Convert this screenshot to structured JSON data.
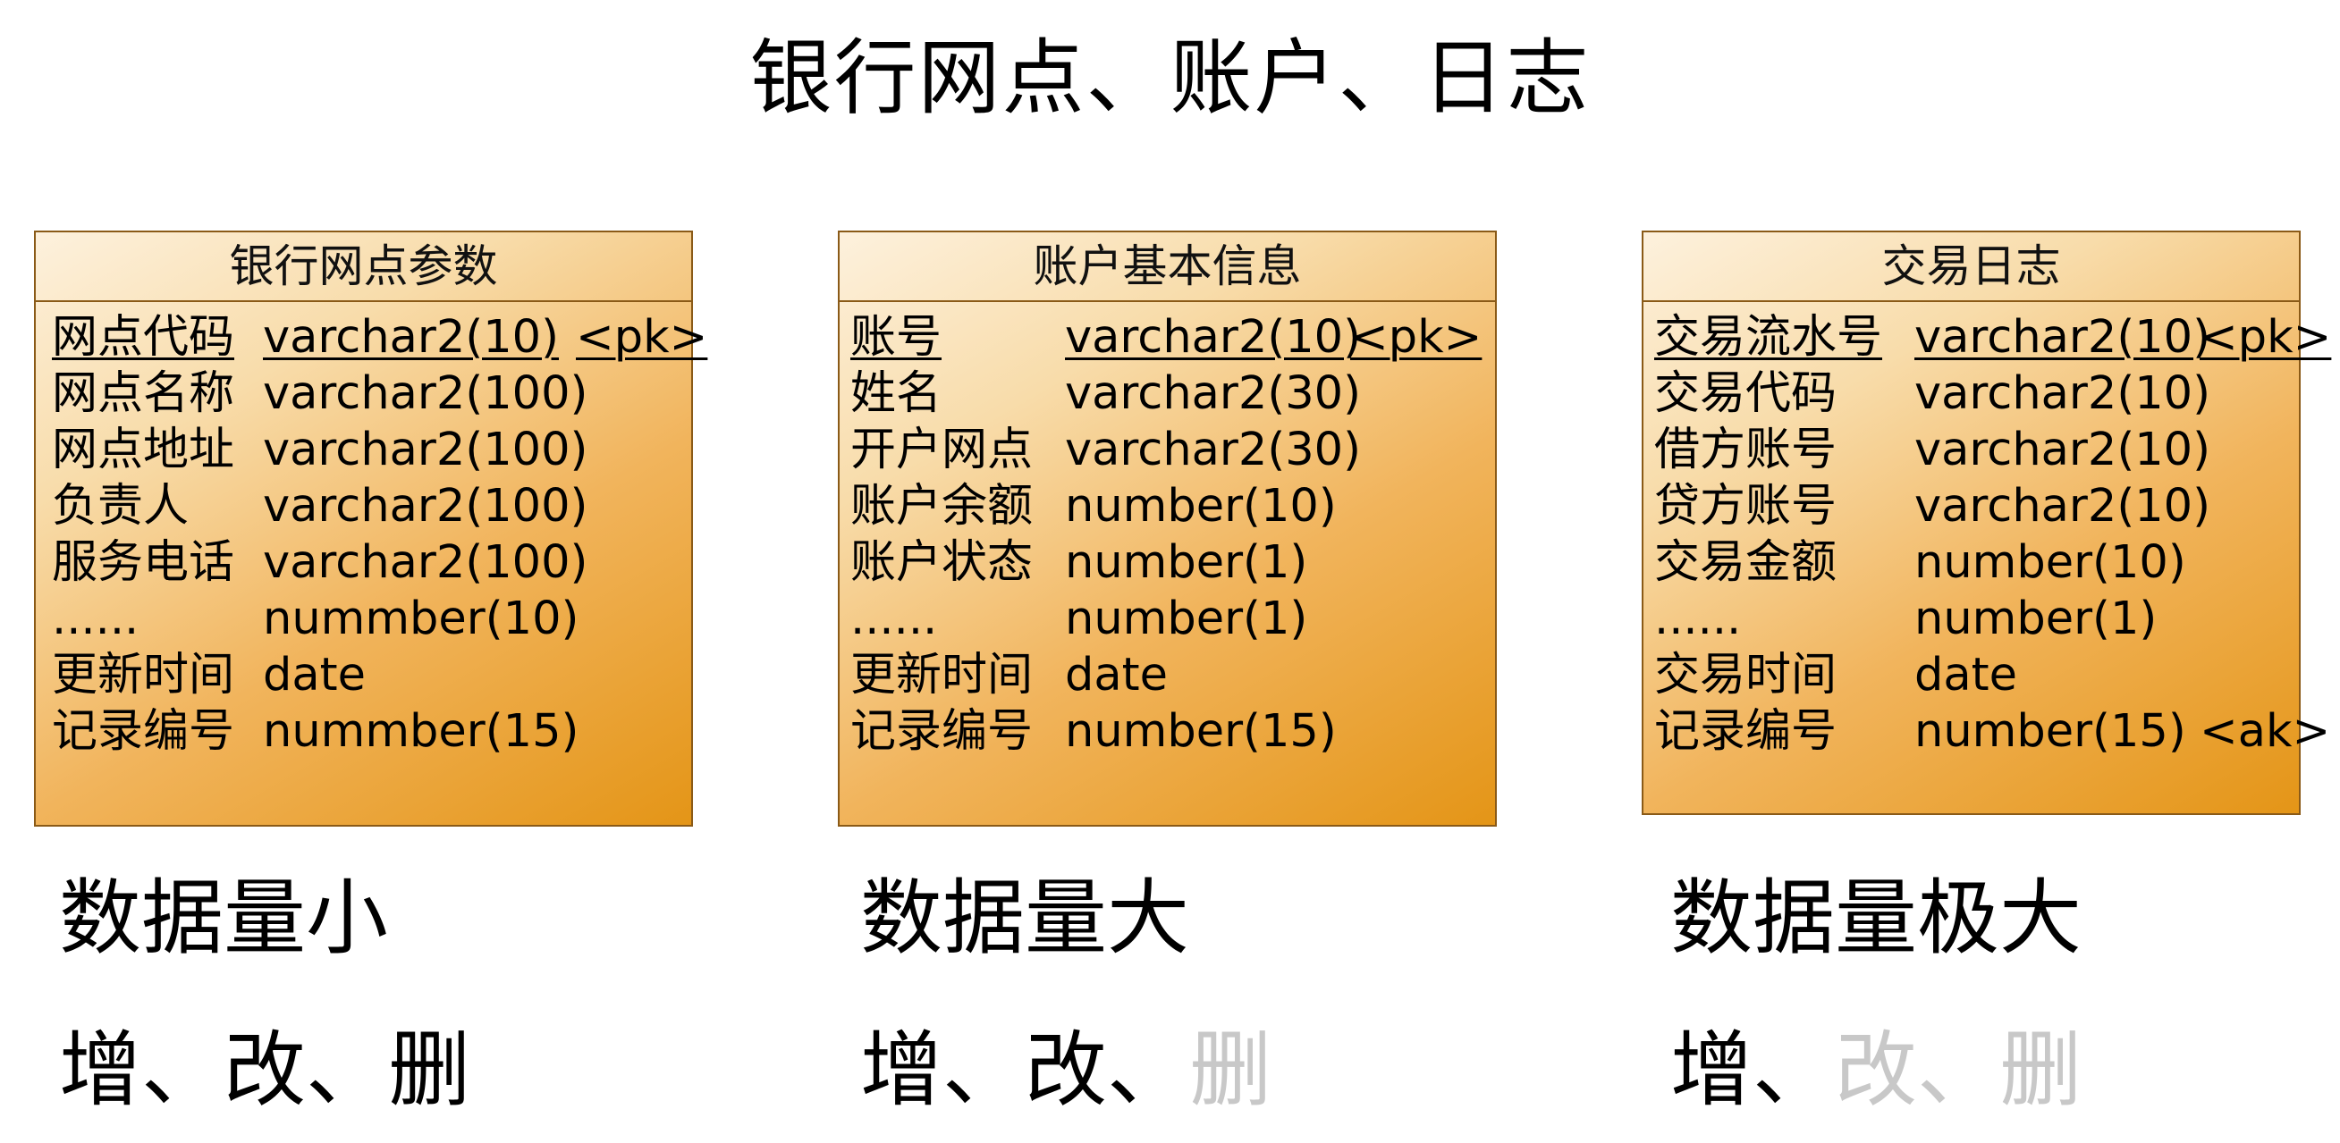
{
  "title": "银行网点、账户、日志",
  "entities": [
    {
      "name": "银行网点参数",
      "rows": [
        {
          "name": "网点代码",
          "type": "varchar2(10)",
          "key": "<pk>"
        },
        {
          "name": "网点名称",
          "type": "varchar2(100)",
          "key": ""
        },
        {
          "name": "网点地址",
          "type": "varchar2(100)",
          "key": ""
        },
        {
          "name": "负责人",
          "type": "varchar2(100)",
          "key": ""
        },
        {
          "name": "服务电话",
          "type": "varchar2(100)",
          "key": ""
        },
        {
          "name": "......",
          "type": "nummber(10)",
          "key": ""
        },
        {
          "name": "更新时间",
          "type": "date",
          "key": ""
        },
        {
          "name": "记录编号",
          "type": "nummber(15)",
          "key": ""
        }
      ]
    },
    {
      "name": "账户基本信息",
      "rows": [
        {
          "name": "账号",
          "type": "varchar2(10)",
          "key": "<pk>"
        },
        {
          "name": "姓名",
          "type": "varchar2(30)",
          "key": ""
        },
        {
          "name": "开户网点",
          "type": "varchar2(30)",
          "key": ""
        },
        {
          "name": "账户余额",
          "type": "number(10)",
          "key": ""
        },
        {
          "name": "账户状态",
          "type": "number(1)",
          "key": ""
        },
        {
          "name": "......",
          "type": "number(1)",
          "key": ""
        },
        {
          "name": "更新时间",
          "type": "date",
          "key": ""
        },
        {
          "name": "记录编号",
          "type": "number(15)",
          "key": ""
        }
      ]
    },
    {
      "name": "交易日志",
      "rows": [
        {
          "name": "交易流水号",
          "type": "varchar2(10)",
          "key": "<pk>"
        },
        {
          "name": "交易代码",
          "type": "varchar2(10)",
          "key": ""
        },
        {
          "name": "借方账号",
          "type": "varchar2(10)",
          "key": ""
        },
        {
          "name": "贷方账号",
          "type": "varchar2(10)",
          "key": ""
        },
        {
          "name": "交易金额",
          "type": "number(10)",
          "key": ""
        },
        {
          "name": "......",
          "type": "number(1)",
          "key": ""
        },
        {
          "name": "交易时间",
          "type": "date",
          "key": ""
        },
        {
          "name": "记录编号",
          "type": "number(15)",
          "key": "<ak>"
        }
      ]
    }
  ],
  "groups": [
    {
      "volume": "数据量小",
      "ops": [
        {
          "label": "增",
          "active": true
        },
        {
          "label": "、",
          "active": true
        },
        {
          "label": "改",
          "active": true
        },
        {
          "label": "、",
          "active": true
        },
        {
          "label": "删",
          "active": true
        }
      ]
    },
    {
      "volume": "数据量大",
      "ops": [
        {
          "label": "增",
          "active": true
        },
        {
          "label": "、",
          "active": true
        },
        {
          "label": "改",
          "active": true
        },
        {
          "label": "、",
          "active": true
        },
        {
          "label": "删",
          "active": false
        }
      ]
    },
    {
      "volume": "数据量极大",
      "ops": [
        {
          "label": "增",
          "active": true
        },
        {
          "label": "、",
          "active": true
        },
        {
          "label": "改",
          "active": false
        },
        {
          "label": "、",
          "active": false
        },
        {
          "label": "删",
          "active": false
        }
      ]
    }
  ],
  "colors": {
    "active_op": "#000000",
    "inactive_op": "#c8c8c8",
    "table_fill_light": "#fdf1dd",
    "table_fill_dark": "#e49517",
    "table_border": "#8a5a17"
  }
}
